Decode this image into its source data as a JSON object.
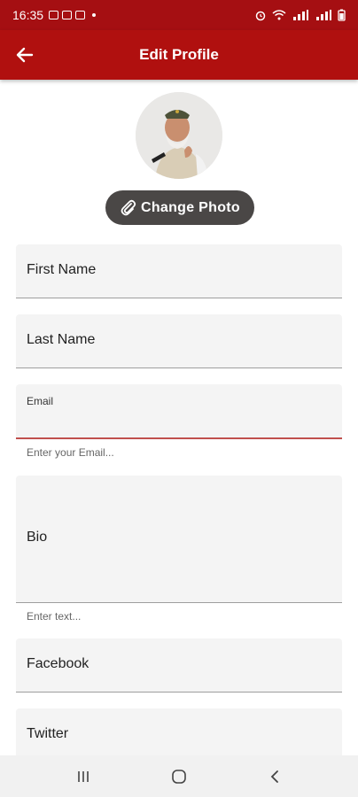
{
  "status_bar": {
    "time": "16:35"
  },
  "app_bar": {
    "title": "Edit Profile"
  },
  "profile": {
    "change_photo_label": "Change Photo"
  },
  "form": {
    "first_name": {
      "label": "First Name"
    },
    "last_name": {
      "label": "Last Name"
    },
    "email": {
      "label": "Email",
      "placeholder": "Enter your Email..."
    },
    "bio": {
      "label": "Bio",
      "helper": "Enter text..."
    },
    "facebook": {
      "label": "Facebook"
    },
    "twitter": {
      "label": "Twitter"
    }
  },
  "colors": {
    "primary": "#b0100f",
    "button_bg": "#4a4746",
    "field_bg": "#f4f4f4"
  }
}
